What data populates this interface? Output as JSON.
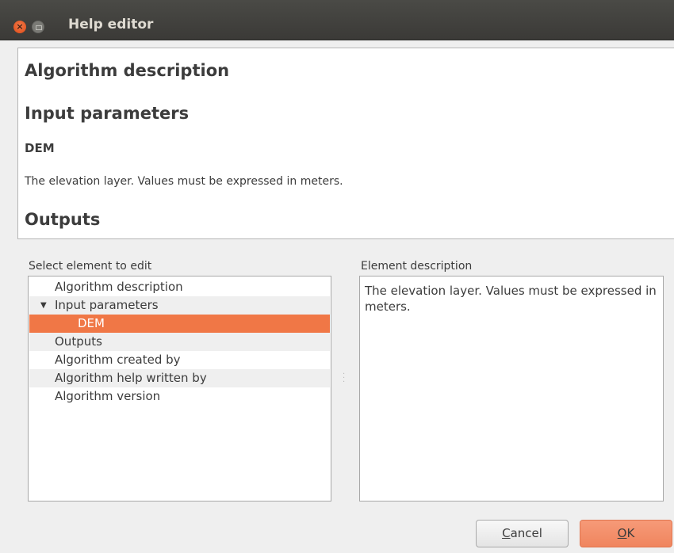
{
  "window": {
    "title": "Help editor",
    "close_glyph": "×"
  },
  "preview": {
    "algorithm_description_heading": "Algorithm description",
    "input_parameters_heading": "Input parameters",
    "param_name": "DEM",
    "param_description": "The elevation layer. Values must be expressed in meters.",
    "outputs_heading": "Outputs"
  },
  "tree": {
    "label": "Select element to edit",
    "items": [
      {
        "label": "Algorithm description"
      },
      {
        "label": "Input parameters",
        "expanded": true
      },
      {
        "label": "DEM",
        "selected": true
      },
      {
        "label": "Outputs"
      },
      {
        "label": "Algorithm created by"
      },
      {
        "label": "Algorithm help written by"
      },
      {
        "label": "Algorithm version"
      }
    ],
    "expand_glyph": "▼"
  },
  "description": {
    "label": "Element description",
    "text": "The elevation layer. Values must be expressed in meters."
  },
  "buttons": {
    "cancel_first": "C",
    "cancel_rest": "ancel",
    "ok_first": "O",
    "ok_rest": "K"
  },
  "colors": {
    "accent": "#f07746",
    "titlebar": "#3c3b37"
  }
}
